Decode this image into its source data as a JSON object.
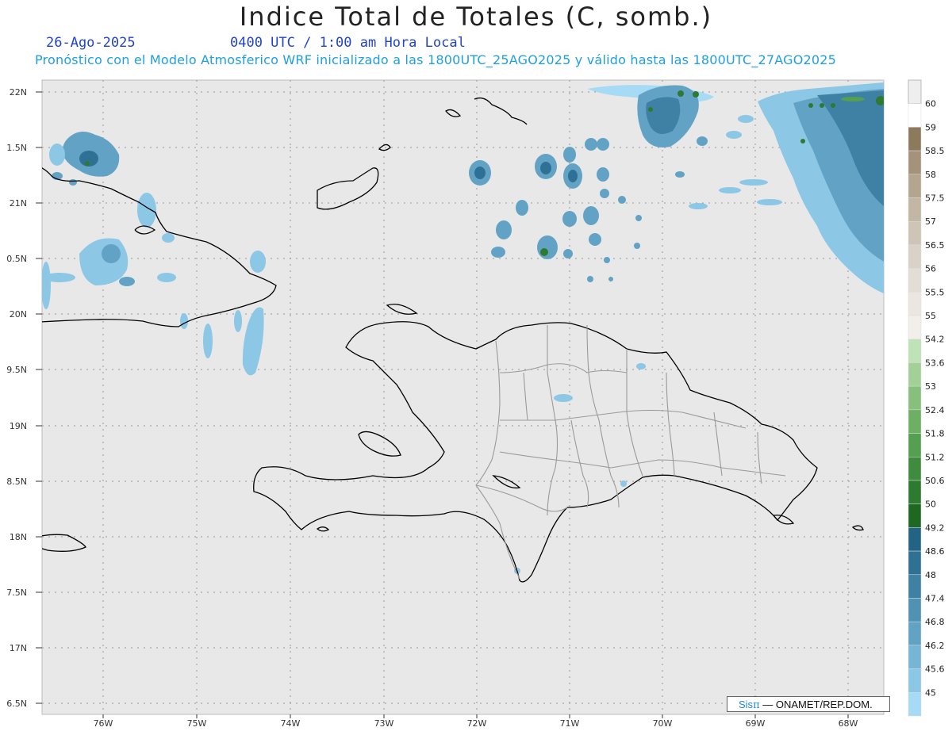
{
  "header": {
    "title": "Indice Total de Totales (C, somb.)",
    "date": "26-Ago-2025",
    "time": "0400 UTC / 1:00 am Hora Local",
    "subtitle": "Pronóstico con el Modelo Atmosferico WRF inicializado a las 1800UTC_25AGO2025 y válido hasta las  1800UTC_27AGO2025"
  },
  "map": {
    "lat_labels": [
      "22N",
      "1.5N",
      "21N",
      "0.5N",
      "20N",
      "9.5N",
      "19N",
      "8.5N",
      "18N",
      "7.5N",
      "17N",
      "6.5N"
    ],
    "lon_labels": [
      "76W",
      "75W",
      "74W",
      "73W",
      "72W",
      "71W",
      "70W",
      "69W",
      "68W"
    ],
    "background_color": "#e8e8e8",
    "coast_color": "#000000",
    "province_border_color": "#9a9a9a"
  },
  "legend": {
    "labels": [
      "60",
      "59",
      "58.5",
      "58",
      "57.5",
      "57",
      "56.5",
      "56",
      "55.5",
      "55",
      "54.2",
      "53.6",
      "53",
      "52.4",
      "51.8",
      "51.2",
      "50.6",
      "50",
      "49.2",
      "48.6",
      "48",
      "47.4",
      "46.8",
      "46.2",
      "45.6",
      "45"
    ],
    "colors": [
      "#ffffff",
      "#8d7a5c",
      "#a4927a",
      "#b4a58f",
      "#c2b6a4",
      "#cfc5b7",
      "#d9d2c7",
      "#e2ddd5",
      "#ebe7e0",
      "#f2efea",
      "#bfe2b6",
      "#a2d097",
      "#87c07c",
      "#6db064",
      "#559f50",
      "#408c3e",
      "#2e7a30",
      "#1e6822",
      "#236486",
      "#2f7195",
      "#3e81a4",
      "#4f92b4",
      "#62a3c5",
      "#76b5d6",
      "#8cc7e6",
      "#a6daf5"
    ],
    "first_box_color": "#eeeeee"
  },
  "credit": {
    "brand_a": "Sis",
    "brand_b": "π",
    "rest": "— ONAMET/REP.DOM."
  }
}
